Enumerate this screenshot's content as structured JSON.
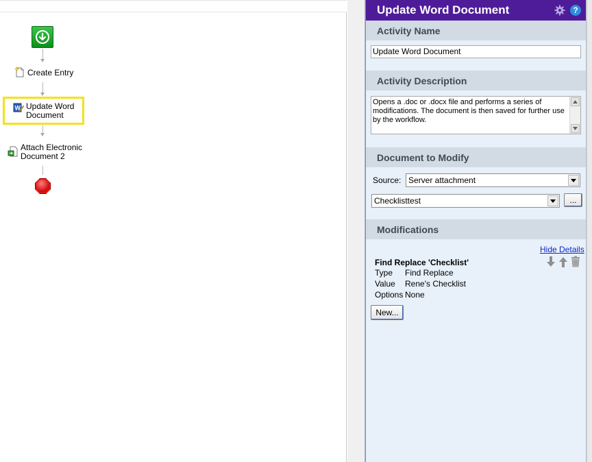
{
  "workflow": {
    "nodes": [
      {
        "label": "Create Entry"
      },
      {
        "label_line1": "Update Word",
        "label_line2": "Document"
      },
      {
        "label_line1": "Attach Electronic",
        "label_line2": "Document 2"
      }
    ]
  },
  "panel": {
    "title": "Update Word Document",
    "sections": {
      "activity_name": {
        "header": "Activity Name",
        "value": "Update Word Document"
      },
      "activity_description": {
        "header": "Activity Description",
        "value": "Opens a .doc or .docx file and performs a series of modifications. The document is then saved for further use by the workflow."
      },
      "document_to_modify": {
        "header": "Document to Modify",
        "source_label": "Source:",
        "source_value": "Server attachment",
        "document_value": "Checklisttest",
        "browse_label": "..."
      },
      "modifications": {
        "header": "Modifications",
        "hide_details_label": "Hide Details",
        "item": {
          "title": "Find Replace 'Checklist'",
          "type_key": "Type",
          "type_value": "Find Replace",
          "value_key": "Value",
          "value_value": "Rene's Checklist",
          "options_key": "Options",
          "options_value": "None"
        },
        "new_button_label": "New..."
      }
    }
  },
  "colors": {
    "header_purple": "#4f1c99",
    "section_bg": "#d2dae4",
    "panel_bg": "#e8f0f9",
    "highlight": "#f3e21a",
    "start_green": "#1ba62c",
    "stop_red": "#e11b1b",
    "link_blue": "#0a28c9"
  },
  "icons": {
    "start": "start-arrow-icon",
    "create_entry": "new-document-icon",
    "word": "word-document-icon",
    "attach": "attach-document-icon",
    "stop": "stop-octagon-icon",
    "settings": "gear-icon",
    "help": "help-icon",
    "move_down": "arrow-down-icon",
    "move_up": "arrow-up-icon",
    "delete": "trash-icon"
  }
}
